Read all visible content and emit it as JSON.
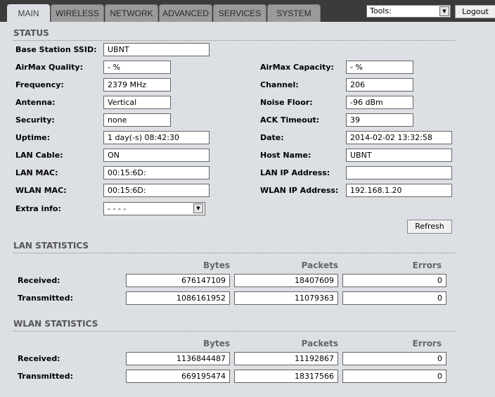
{
  "tabs": [
    "MAIN",
    "WIRELESS",
    "NETWORK",
    "ADVANCED",
    "SERVICES",
    "SYSTEM"
  ],
  "tools_label": "Tools:",
  "logout": "Logout",
  "status_title": "STATUS",
  "left": [
    {
      "label": "Base Station SSID:",
      "value": "UBNT"
    },
    {
      "label": "AirMax Quality:",
      "value": "- %"
    },
    {
      "label": "Frequency:",
      "value": "2379 MHz"
    },
    {
      "label": "Antenna:",
      "value": "Vertical"
    },
    {
      "label": "Security:",
      "value": "none"
    },
    {
      "label": "Uptime:",
      "value": "1 day(-s) 08:42:30"
    },
    {
      "label": "LAN Cable:",
      "value": "ON"
    },
    {
      "label": "LAN MAC:",
      "value": "00:15:6D:"
    },
    {
      "label": "WLAN MAC:",
      "value": "00:15:6D:"
    },
    {
      "label": "Extra info:",
      "value": "- - - -"
    }
  ],
  "right": [
    {
      "label": "AirMax Capacity:",
      "value": "- %"
    },
    {
      "label": "Channel:",
      "value": "206"
    },
    {
      "label": "Noise Floor:",
      "value": "-96 dBm"
    },
    {
      "label": "ACK Timeout:",
      "value": "39"
    },
    {
      "label": "Date:",
      "value": "2014-02-02 13:32:58"
    },
    {
      "label": "Host Name:",
      "value": "UBNT"
    },
    {
      "label": "LAN IP Address:",
      "value": ""
    },
    {
      "label": "WLAN IP Address:",
      "value": "192.168.1.20"
    }
  ],
  "refresh": "Refresh",
  "columns": [
    "Bytes",
    "Packets",
    "Errors"
  ],
  "lan": {
    "title": "LAN STATISTICS",
    "rows": [
      {
        "label": "Received:",
        "values": [
          "676147109",
          "18407609",
          "0"
        ]
      },
      {
        "label": "Transmitted:",
        "values": [
          "1086161952",
          "11079363",
          "0"
        ]
      }
    ]
  },
  "wlan": {
    "title": "WLAN STATISTICS",
    "rows": [
      {
        "label": "Received:",
        "values": [
          "1136844487",
          "11192867",
          "0"
        ]
      },
      {
        "label": "Transmitted:",
        "values": [
          "669195474",
          "18317566",
          "0"
        ]
      }
    ]
  }
}
